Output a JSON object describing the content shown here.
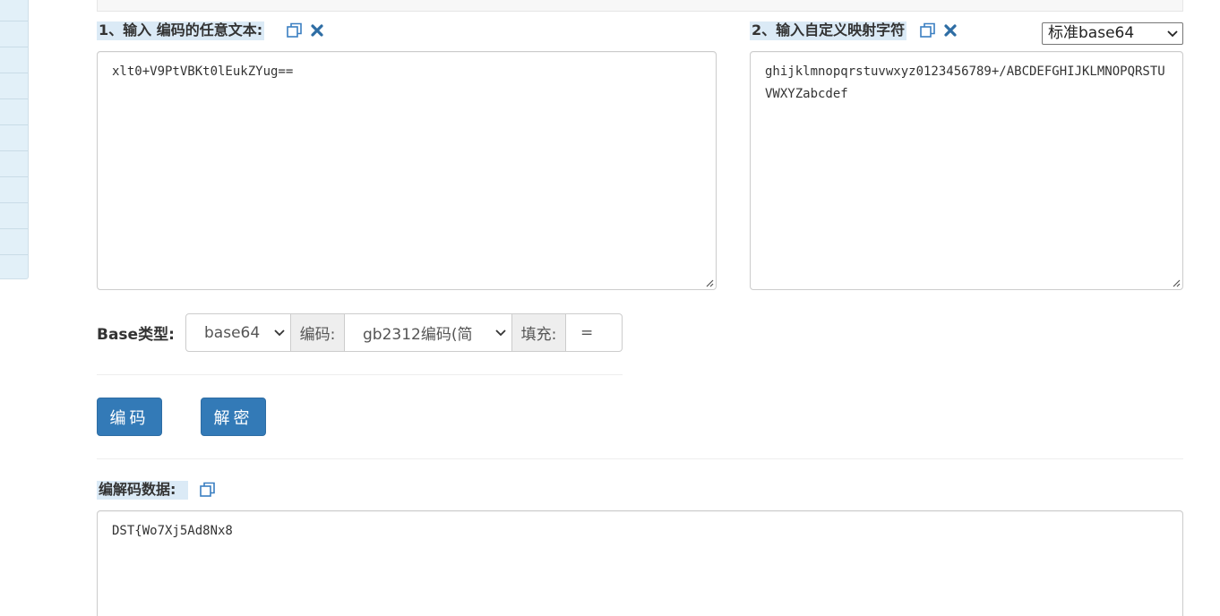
{
  "input_section": {
    "label": "1、输入 编码的任意文本:",
    "text": "xlt0+V9PtVBKt0lEukZYug=="
  },
  "mapping_section": {
    "label": "2、输入自定义映射字符",
    "text": "ghijklmnopqrstuvwxyz0123456789+/ABCDEFGHIJKLMNOPQRSTUVWXYZabcdef",
    "preset_select": "标准base64"
  },
  "options": {
    "base_type_label": "Base类型:",
    "base_type_value": "base64",
    "encoding_label": "编码:",
    "encoding_value": "gb2312编码(简",
    "padding_label": "填充:",
    "padding_value": "="
  },
  "buttons": {
    "encode": "编码",
    "decode": "解密"
  },
  "output_section": {
    "label": "编解码数据:",
    "text": "DST{Wo7Xj5Ad8Nx8"
  },
  "colors": {
    "accent": "#337ab7",
    "label_highlight": "#dbeaf6"
  },
  "icons": [
    "copy-icon",
    "clear-icon",
    "chevron-down-icon"
  ]
}
